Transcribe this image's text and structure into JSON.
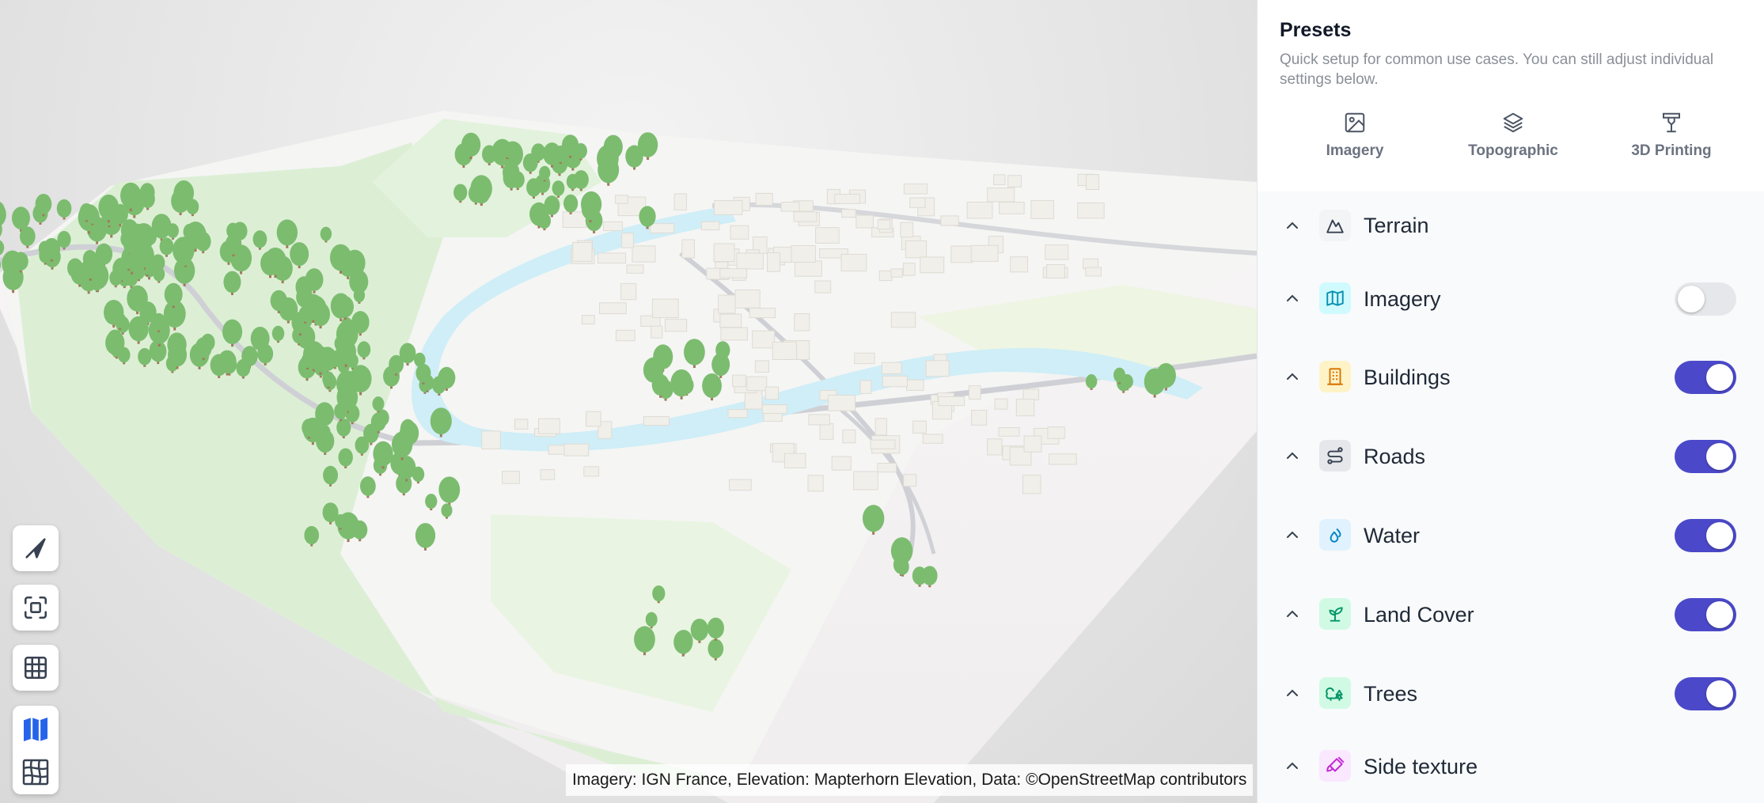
{
  "viewport": {
    "attribution": "Imagery: IGN France, Elevation: Mapterhorn Elevation, Data: ©OpenStreetMap contributors",
    "controls": [
      {
        "name": "navigate-icon"
      },
      {
        "name": "fit-view-icon"
      },
      {
        "name": "grid-icon"
      }
    ],
    "layer_switch": [
      {
        "name": "map-layer-icon",
        "active": true
      },
      {
        "name": "terrain-mesh-icon",
        "active": false
      }
    ]
  },
  "presets": {
    "title": "Presets",
    "description": "Quick setup for common use cases. You can still adjust individual settings below.",
    "items": [
      {
        "label": "Imagery",
        "icon": "image-icon"
      },
      {
        "label": "Topographic",
        "icon": "layers-icon"
      },
      {
        "label": "3D Printing",
        "icon": "printer-icon"
      }
    ]
  },
  "sections": [
    {
      "label": "Terrain",
      "icon": "mountain-icon",
      "icon_bg": "#f3f4f6",
      "icon_color": "#374151",
      "toggle": null
    },
    {
      "label": "Imagery",
      "icon": "map-icon",
      "icon_bg": "#cffafe",
      "icon_color": "#0891b2",
      "toggle": false
    },
    {
      "label": "Buildings",
      "icon": "building-icon",
      "icon_bg": "#fef3c7",
      "icon_color": "#d97706",
      "toggle": true
    },
    {
      "label": "Roads",
      "icon": "route-icon",
      "icon_bg": "#e5e7eb",
      "icon_color": "#374151",
      "toggle": true
    },
    {
      "label": "Water",
      "icon": "droplets-icon",
      "icon_bg": "#e0f2fe",
      "icon_color": "#0284c7",
      "toggle": true
    },
    {
      "label": "Land Cover",
      "icon": "sprout-icon",
      "icon_bg": "#d1fae5",
      "icon_color": "#059669",
      "toggle": true
    },
    {
      "label": "Trees",
      "icon": "trees-icon",
      "icon_bg": "#d1fae5",
      "icon_color": "#059669",
      "toggle": true
    },
    {
      "label": "Side texture",
      "icon": "brush-icon",
      "icon_bg": "#fae8ff",
      "icon_color": "#c026d3",
      "toggle": null
    }
  ],
  "colors": {
    "accent": "#4b49c9",
    "water": "#cfeef7",
    "forest": "#d9efd2",
    "tree": "#7cbc6f",
    "building": "#f1efea"
  }
}
